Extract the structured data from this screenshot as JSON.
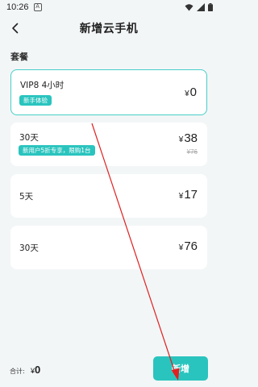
{
  "status_bar": {
    "time": "10:26",
    "notif_letter": "A"
  },
  "header": {
    "title": "新增云手机"
  },
  "section": {
    "title": "套餐"
  },
  "plans": [
    {
      "name": "VIP8 4小时",
      "badge": "新手体验",
      "currency": "¥",
      "price": "0",
      "old_price": ""
    },
    {
      "name": "30天",
      "badge": "新用户5折专享，限购1台",
      "currency": "¥",
      "price": "38",
      "old_price": "¥76"
    },
    {
      "name": "5天",
      "badge": "",
      "currency": "¥",
      "price": "17",
      "old_price": ""
    },
    {
      "name": "30天",
      "badge": "",
      "currency": "¥",
      "price": "76",
      "old_price": ""
    }
  ],
  "footer": {
    "total_label": "合计:",
    "currency": "¥",
    "total": "0",
    "add_button": "新增"
  },
  "colors": {
    "accent": "#2ac4be",
    "selected_border": "#46cfc9",
    "arrow": "#e02020",
    "background": "#f3f6f7"
  },
  "icons": {
    "back": "back-arrow-icon",
    "wifi": "wifi-icon",
    "signal": "signal-icon",
    "battery": "battery-icon"
  }
}
